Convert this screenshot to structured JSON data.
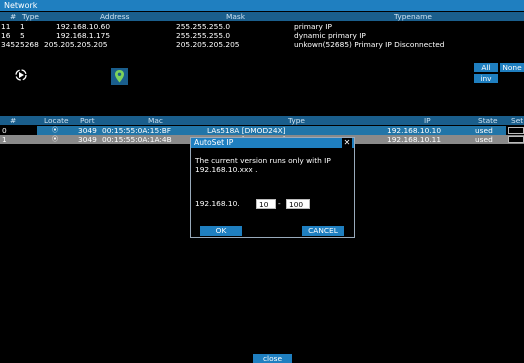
{
  "window": {
    "title": "Network"
  },
  "network": {
    "headers": [
      "#",
      "Type",
      "Address",
      "Mask",
      "Typename"
    ],
    "rows": [
      {
        "num": "11",
        "type": "1",
        "address": "192.168.10.60",
        "mask": "255.255.255.0",
        "typename": "primary IP"
      },
      {
        "num": "16",
        "type": "5",
        "address": "192.168.1.175",
        "mask": "255.255.255.0",
        "typename": "dynamic primary IP"
      },
      {
        "num": "3452",
        "type": "5268",
        "address": "205.205.205.205",
        "mask": "205.205.205.205",
        "typename": "unkown(52685) Primary IP Disconnected"
      }
    ]
  },
  "filters": {
    "all": "All",
    "none": "None",
    "inv": "inv"
  },
  "devices": {
    "headers": [
      "#",
      "Locate",
      "Port",
      "Mac",
      "Type",
      "IP",
      "State",
      "Set"
    ],
    "rows": [
      {
        "num": "0",
        "port": "3049",
        "mac": "00:15:55:0A:15:BF",
        "type": "LAs518A [DMOD24X]",
        "ip": "192.168.10.10",
        "state": "used",
        "selected": false
      },
      {
        "num": "1",
        "port": "3049",
        "mac": "00:15:55:0A:1A:4B",
        "type": "LAs518A [DMOD24X]",
        "ip": "192.168.10.11",
        "state": "used",
        "selected": true
      }
    ]
  },
  "dialog": {
    "title": "AutoSet IP",
    "close": "✕",
    "message": "The current version runs only with IP 192.168.10.xxx .",
    "prefix": "192.168.10.",
    "from_value": "10",
    "separator": "-",
    "to_value": "100",
    "ok": "OK",
    "cancel": "CANCEL"
  },
  "footer": {
    "close": "close"
  },
  "colors": {
    "accent": "#1f7fc0",
    "header": "#1a5e8c",
    "selected_row": "#8a8a8a"
  }
}
